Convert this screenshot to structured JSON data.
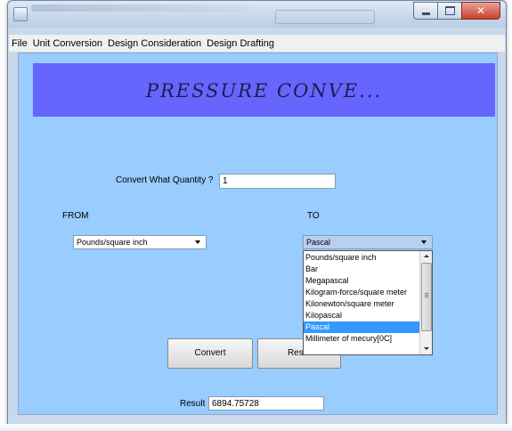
{
  "menu": [
    "File",
    "Unit Conversion",
    "Design Consideration",
    "Design Drafting"
  ],
  "banner": {
    "title": "PRESSURE  CONVE..."
  },
  "form": {
    "quantity_label": "Convert What Quantity ?",
    "quantity_value": "1",
    "from_label": "FROM",
    "to_label": "TO",
    "from_selected": "Pounds/square inch",
    "to_selected": "Pascal",
    "result_label": "Result",
    "result_value": "6894.75728"
  },
  "buttons": {
    "convert": "Convert",
    "reset": "Reset"
  },
  "to_options": [
    "Pounds/square inch",
    "Bar",
    "Megapascal",
    "Kilogram-force/square meter",
    "Kilonewton/square meter",
    "Kilopascal",
    "Pascal",
    "Millimeter of mecury[0C]"
  ],
  "highlighted_option": "Pascal",
  "colors": {
    "content_bg": "#99ccff",
    "banner_bg": "#6666ff",
    "selection": "#3399ff"
  },
  "icons": [
    "app-icon",
    "minimize-icon",
    "maximize-icon",
    "close-icon",
    "chevron-down-icon"
  ]
}
